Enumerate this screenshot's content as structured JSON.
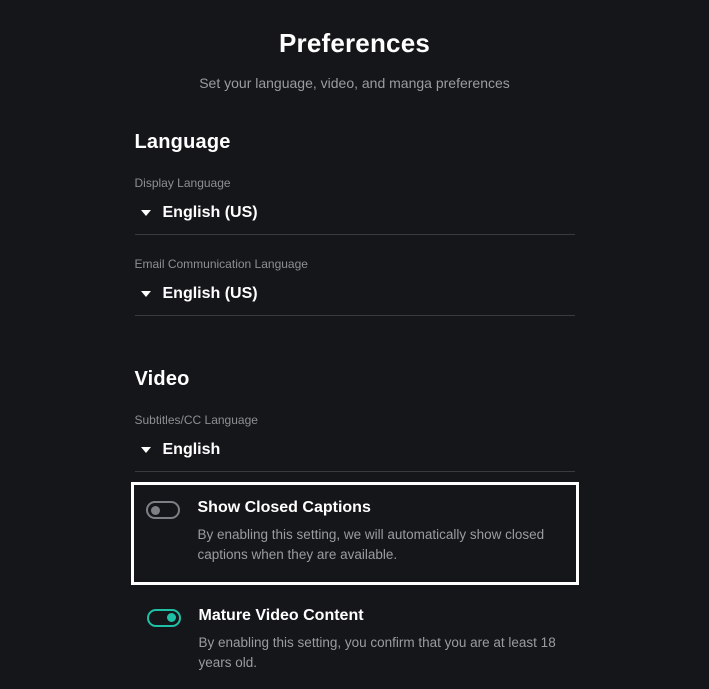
{
  "header": {
    "title": "Preferences",
    "subtitle": "Set your language, video, and manga preferences"
  },
  "language": {
    "heading": "Language",
    "display": {
      "label": "Display Language",
      "value": "English (US)"
    },
    "email": {
      "label": "Email Communication Language",
      "value": "English (US)"
    }
  },
  "video": {
    "heading": "Video",
    "subtitles": {
      "label": "Subtitles/CC Language",
      "value": "English"
    },
    "cc": {
      "title": "Show Closed Captions",
      "desc": "By enabling this setting, we will automatically show closed captions when they are available.",
      "on": false
    },
    "mature": {
      "title": "Mature Video Content",
      "desc": "By enabling this setting, you confirm that you are at least 18 years old.",
      "on": true
    }
  }
}
